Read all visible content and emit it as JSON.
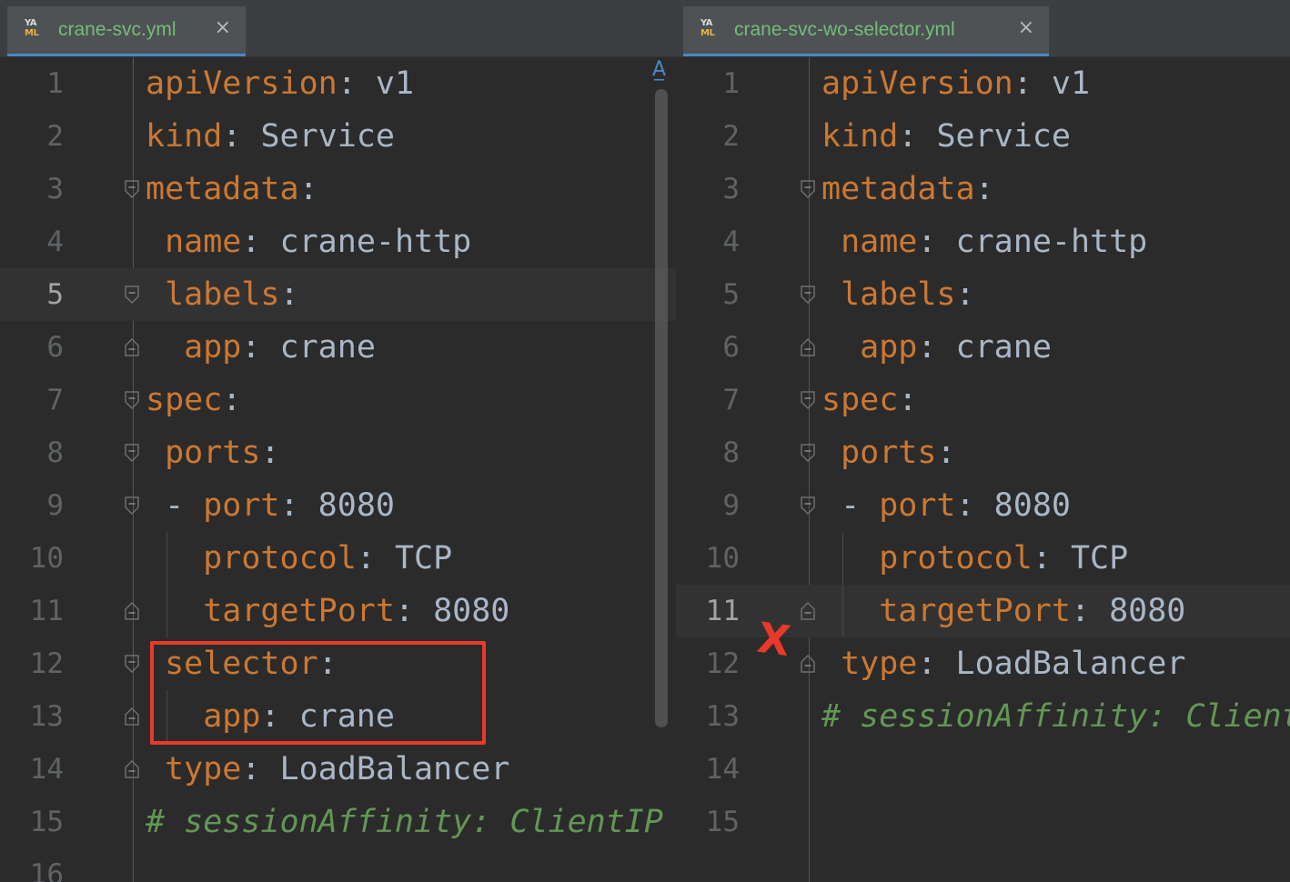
{
  "left": {
    "tab": {
      "title": "crane-svc.yml",
      "close": "×",
      "icon_lines": [
        "YA",
        "ML"
      ]
    },
    "active_line": 5,
    "lines": [
      {
        "n": "1",
        "indent": "",
        "key": "apiVersion",
        "sep": ": ",
        "val": "v1"
      },
      {
        "n": "2",
        "indent": "",
        "key": "kind",
        "sep": ": ",
        "val": "Service"
      },
      {
        "n": "3",
        "indent": "",
        "key": "metadata",
        "sep": ":",
        "val": ""
      },
      {
        "n": "4",
        "indent": " ",
        "key": "name",
        "sep": ": ",
        "val": "crane-http"
      },
      {
        "n": "5",
        "indent": " ",
        "key": "labels",
        "sep": ":",
        "val": ""
      },
      {
        "n": "6",
        "indent": "  ",
        "key": "app",
        "sep": ": ",
        "val": "crane"
      },
      {
        "n": "7",
        "indent": "",
        "key": "spec",
        "sep": ":",
        "val": ""
      },
      {
        "n": "8",
        "indent": " ",
        "key": "ports",
        "sep": ":",
        "val": ""
      },
      {
        "n": "9",
        "indent": " - ",
        "key": "port",
        "sep": ": ",
        "val": "8080"
      },
      {
        "n": "10",
        "indent": "   ",
        "key": "protocol",
        "sep": ": ",
        "val": "TCP"
      },
      {
        "n": "11",
        "indent": "   ",
        "key": "targetPort",
        "sep": ": ",
        "val": "8080"
      },
      {
        "n": "12",
        "indent": " ",
        "key": "selector",
        "sep": ":",
        "val": ""
      },
      {
        "n": "13",
        "indent": "   ",
        "key": "app",
        "sep": ": ",
        "val": "crane"
      },
      {
        "n": "14",
        "indent": " ",
        "key": "type",
        "sep": ": ",
        "val": "LoadBalancer"
      },
      {
        "n": "15",
        "indent": "",
        "comment": "# sessionAffinity: ClientIP"
      },
      {
        "n": "16",
        "indent": "",
        "key": "",
        "sep": "",
        "val": ""
      }
    ]
  },
  "right": {
    "tab": {
      "title": "crane-svc-wo-selector.yml",
      "close": "×",
      "icon_lines": [
        "YA",
        "ML"
      ]
    },
    "active_line": 11,
    "lines": [
      {
        "n": "1",
        "indent": "",
        "key": "apiVersion",
        "sep": ": ",
        "val": "v1"
      },
      {
        "n": "2",
        "indent": "",
        "key": "kind",
        "sep": ": ",
        "val": "Service"
      },
      {
        "n": "3",
        "indent": "",
        "key": "metadata",
        "sep": ":",
        "val": ""
      },
      {
        "n": "4",
        "indent": " ",
        "key": "name",
        "sep": ": ",
        "val": "crane-http"
      },
      {
        "n": "5",
        "indent": " ",
        "key": "labels",
        "sep": ":",
        "val": ""
      },
      {
        "n": "6",
        "indent": "  ",
        "key": "app",
        "sep": ": ",
        "val": "crane"
      },
      {
        "n": "7",
        "indent": "",
        "key": "spec",
        "sep": ":",
        "val": ""
      },
      {
        "n": "8",
        "indent": " ",
        "key": "ports",
        "sep": ":",
        "val": ""
      },
      {
        "n": "9",
        "indent": " - ",
        "key": "port",
        "sep": ": ",
        "val": "8080"
      },
      {
        "n": "10",
        "indent": "   ",
        "key": "protocol",
        "sep": ": ",
        "val": "TCP"
      },
      {
        "n": "11",
        "indent": "   ",
        "key": "targetPort",
        "sep": ": ",
        "val": "8080"
      },
      {
        "n": "12",
        "indent": " ",
        "key": "type",
        "sep": ": ",
        "val": "LoadBalancer"
      },
      {
        "n": "13",
        "indent": "",
        "comment": "# sessionAffinity: ClientIP"
      },
      {
        "n": "14",
        "indent": "",
        "key": "",
        "sep": "",
        "val": ""
      },
      {
        "n": "15",
        "indent": "",
        "key": "",
        "sep": "",
        "val": ""
      }
    ]
  },
  "annotations": {
    "removed_marker": "X",
    "inspection_icon": "inspection-widget-icon"
  },
  "colors": {
    "background": "#2b2b2b",
    "key": "#cc7832",
    "value": "#a9b7c6",
    "comment": "#629755",
    "line_number": "#5f6366",
    "tab_title": "#73bd79",
    "annotation_red": "#e8392b"
  }
}
